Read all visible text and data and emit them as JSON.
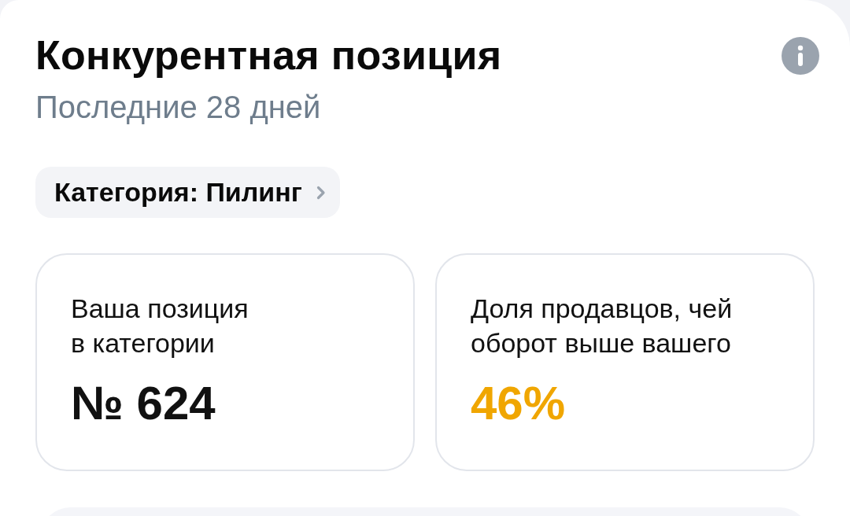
{
  "header": {
    "title": "Конкурентная позиция",
    "subtitle": "Последние 28 дней"
  },
  "category_chip": {
    "label": "Категория: Пилинг"
  },
  "stats": [
    {
      "label_lines": [
        "Ваша позиция",
        "в категории"
      ],
      "value": "№ 624",
      "color": "#111111"
    },
    {
      "label_lines": [
        "Доля продавцов, чей",
        "оборот выше вашего"
      ],
      "value": "46%",
      "color": "#f0a600"
    }
  ]
}
